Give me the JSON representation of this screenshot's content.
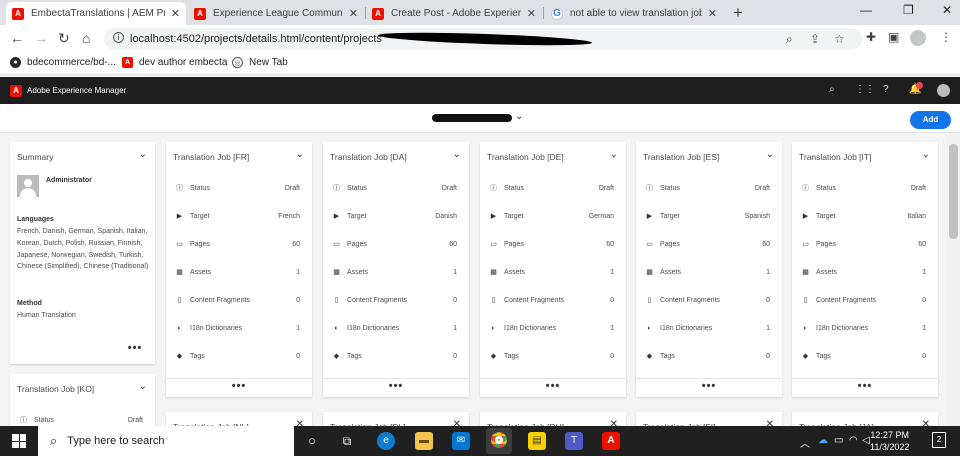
{
  "browser": {
    "tabs": [
      {
        "title": "EmbectaTranslations | AEM Proje",
        "icon": "adobe-icon",
        "active": true
      },
      {
        "title": "Experience League Community",
        "icon": "adobe-icon",
        "active": false
      },
      {
        "title": "Create Post - Adobe Experience",
        "icon": "adobe-icon",
        "active": false
      },
      {
        "title": "not able to view translation jobs",
        "icon": "google-icon",
        "active": false
      }
    ],
    "url": "localhost:4502/projects/details.html/content/projects",
    "bookmarks": [
      {
        "label": "bdecommerce/bd-...",
        "icon": "github-icon"
      },
      {
        "label": "dev author embecta",
        "icon": "adobe-icon"
      },
      {
        "label": "New Tab",
        "icon": "globe-icon"
      }
    ]
  },
  "aem": {
    "product_title": "Adobe Experience Manager",
    "add_label": "Add",
    "notification_count": "2"
  },
  "summary": {
    "title": "Summary",
    "user": "Administrator",
    "languages_label": "Languages",
    "languages": "French, Danish, German, Spanish, Italian, Korean, Dutch, Polish, Russian, Finnish, Japanese, Norwegian, Swedish, Turkish, Chinese (Simplified), Chinese (Traditional)",
    "method_label": "Method",
    "method": "Human Translation"
  },
  "jobs": [
    {
      "title": "Translation Job [FR]",
      "status": "Draft",
      "target": "French",
      "pages": "60",
      "assets": "1",
      "content_fragments": "0",
      "i18n": "1",
      "tags": "0"
    },
    {
      "title": "Translation Job [DA]",
      "status": "Draft",
      "target": "Danish",
      "pages": "60",
      "assets": "1",
      "content_fragments": "0",
      "i18n": "1",
      "tags": "0"
    },
    {
      "title": "Translation Job [DE]",
      "status": "Draft",
      "target": "German",
      "pages": "60",
      "assets": "1",
      "content_fragments": "0",
      "i18n": "1",
      "tags": "0"
    },
    {
      "title": "Translation Job [ES]",
      "status": "Draft",
      "target": "Spanish",
      "pages": "60",
      "assets": "1",
      "content_fragments": "0",
      "i18n": "1",
      "tags": "0"
    },
    {
      "title": "Translation Job [IT]",
      "status": "Draft",
      "target": "Italian",
      "pages": "60",
      "assets": "1",
      "content_fragments": "0",
      "i18n": "1",
      "tags": "0"
    }
  ],
  "job_ko": {
    "title": "Translation Job [KO]",
    "status": "Draft"
  },
  "partial_jobs": [
    "Translation Job [NL]",
    "Translation Job [PL]",
    "Translation Job [RU]",
    "Translation Job [FI]",
    "Translation Job [JA]"
  ],
  "row_labels": {
    "status": "Status",
    "target": "Target",
    "pages": "Pages",
    "assets": "Assets",
    "content_fragments": "Content Fragments",
    "i18n": "I18n Dictionaries",
    "tags": "Tags"
  },
  "more_label": "•••",
  "taskbar": {
    "search_placeholder": "Type here to search",
    "time": "12:27 PM",
    "date": "11/3/2022",
    "notifications": "2"
  }
}
